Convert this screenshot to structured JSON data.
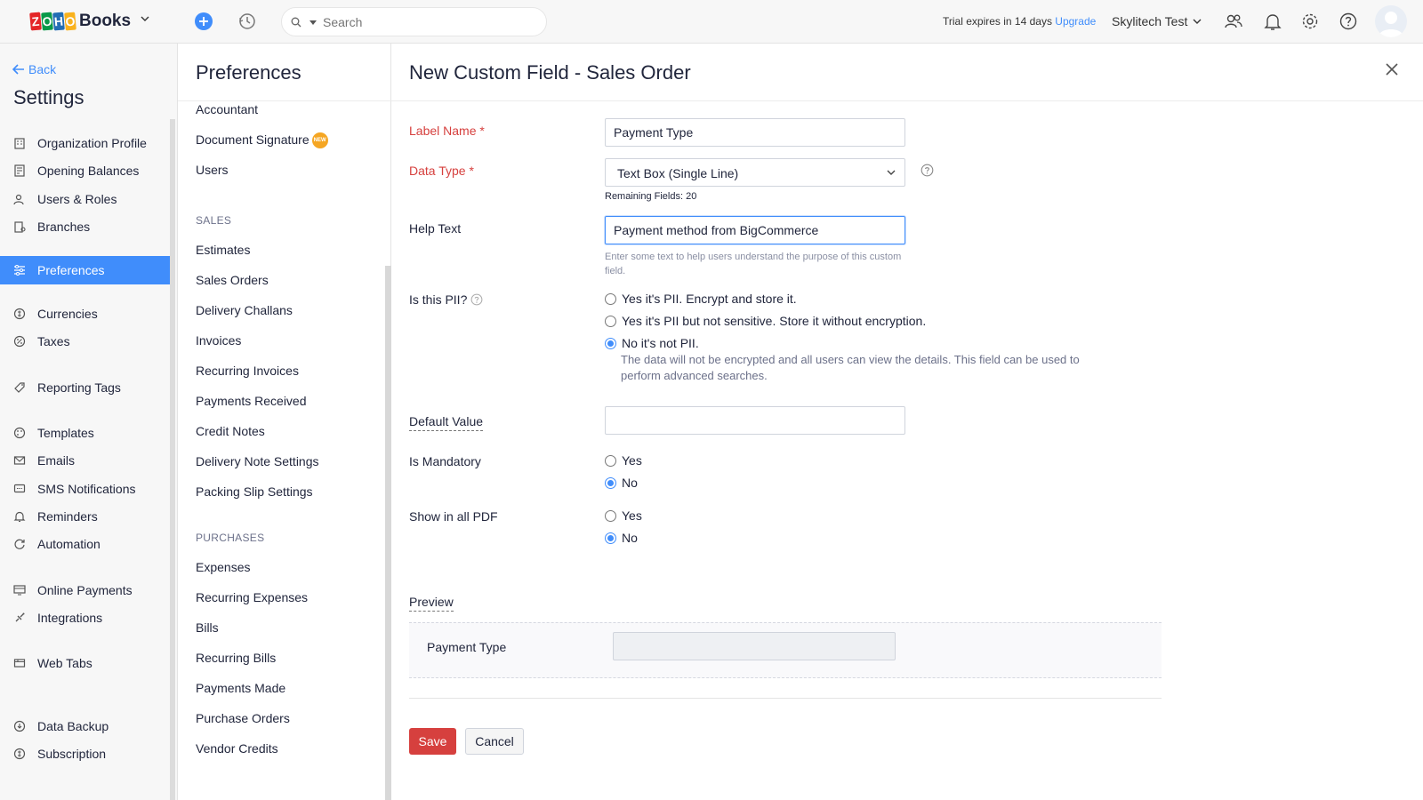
{
  "topbar": {
    "logo_letters": [
      "Z",
      "O",
      "H",
      "O"
    ],
    "logo_product": "Books",
    "search_placeholder": "Search",
    "trial_text": "Trial expires in 14 days",
    "upgrade_link": "Upgrade",
    "org_name": "Skylitech Test"
  },
  "sidebar": {
    "back_label": "Back",
    "title": "Settings",
    "items": [
      {
        "label": "Organization Profile",
        "icon": "organization-icon"
      },
      {
        "label": "Opening Balances",
        "icon": "balance-icon"
      },
      {
        "label": "Users & Roles",
        "icon": "users-icon"
      },
      {
        "label": "Branches",
        "icon": "branches-icon"
      },
      {
        "label": "Preferences",
        "icon": "preferences-icon",
        "active": true
      },
      {
        "label": "Currencies",
        "icon": "currency-icon"
      },
      {
        "label": "Taxes",
        "icon": "taxes-icon"
      },
      {
        "label": "Reporting Tags",
        "icon": "tag-icon"
      },
      {
        "label": "Templates",
        "icon": "palette-icon"
      },
      {
        "label": "Emails",
        "icon": "email-icon"
      },
      {
        "label": "SMS Notifications",
        "icon": "sms-icon"
      },
      {
        "label": "Reminders",
        "icon": "bell-icon"
      },
      {
        "label": "Automation",
        "icon": "automation-icon"
      },
      {
        "label": "Online Payments",
        "icon": "payment-icon"
      },
      {
        "label": "Integrations",
        "icon": "integration-icon"
      },
      {
        "label": "Web Tabs",
        "icon": "webtabs-icon"
      },
      {
        "label": "Data Backup",
        "icon": "backup-icon"
      },
      {
        "label": "Subscription",
        "icon": "subscription-icon"
      }
    ]
  },
  "preferences": {
    "title": "Preferences",
    "top_items": [
      "Accountant",
      "Document Signature",
      "Users"
    ],
    "new_badge": "NEW",
    "sales_heading": "SALES",
    "sales_items": [
      "Estimates",
      "Sales Orders",
      "Delivery Challans",
      "Invoices",
      "Recurring Invoices",
      "Payments Received",
      "Credit Notes",
      "Delivery Note Settings",
      "Packing Slip Settings"
    ],
    "purchases_heading": "PURCHASES",
    "purchases_items": [
      "Expenses",
      "Recurring Expenses",
      "Bills",
      "Recurring Bills",
      "Payments Made",
      "Purchase Orders",
      "Vendor Credits"
    ]
  },
  "form": {
    "title": "New Custom Field - Sales Order",
    "label_name_label": "Label Name *",
    "label_name_value": "Payment Type",
    "data_type_label": "Data Type *",
    "data_type_value": "Text Box (Single Line)",
    "remaining_fields": "Remaining Fields: 20",
    "help_text_label": "Help Text",
    "help_text_value": "Payment method from BigCommerce",
    "help_text_hint": "Enter some text to help users understand the purpose of this custom field.",
    "pii_label": "Is this PII?",
    "pii_options": [
      {
        "label": "Yes it's PII. Encrypt and store it.",
        "checked": false
      },
      {
        "label": "Yes it's PII but not sensitive. Store it without encryption.",
        "checked": false
      },
      {
        "label": "No it's not PII.",
        "checked": true
      }
    ],
    "pii_description": "The data will not be encrypted and all users can view the details. This field can be used to perform advanced searches.",
    "default_value_label": "Default Value",
    "default_value": "",
    "mandatory_label": "Is Mandatory",
    "mandatory_yes": "Yes",
    "mandatory_no": "No",
    "mandatory_selected": "No",
    "show_pdf_label": "Show in all PDF",
    "show_pdf_yes": "Yes",
    "show_pdf_no": "No",
    "show_pdf_selected": "No",
    "preview_heading": "Preview",
    "preview_field_label": "Payment Type",
    "save_label": "Save",
    "cancel_label": "Cancel"
  },
  "colors": {
    "accent": "#408dfb",
    "danger": "#d6403e",
    "sidebar_bg": "#f7f7f7"
  }
}
